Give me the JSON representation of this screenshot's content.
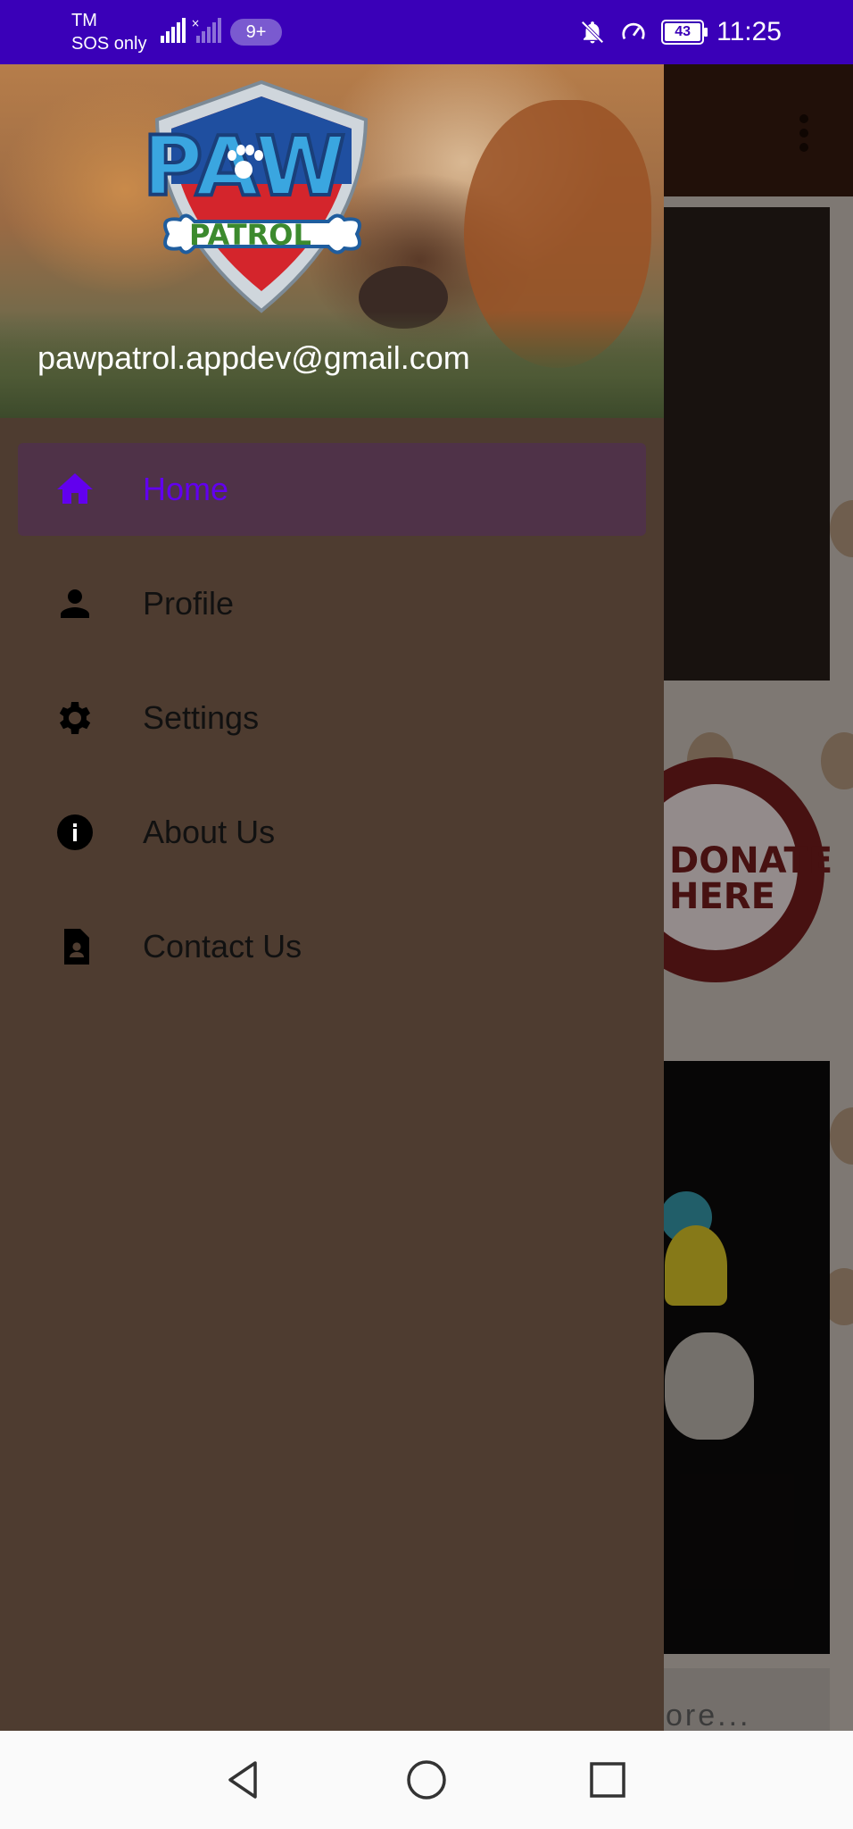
{
  "status_bar": {
    "carrier_line1": "TM",
    "carrier_line2": "SOS only",
    "notification_count": "9+",
    "battery": "43",
    "time": "11:25",
    "bg_color": "#3a00b8"
  },
  "drawer": {
    "email": "pawpatrol.appdev@gmail.com",
    "logo_text": "PAW",
    "logo_banner": "PATROL",
    "items": [
      {
        "label": "Home",
        "icon": "home-icon",
        "active": true
      },
      {
        "label": "Profile",
        "icon": "person-icon",
        "active": false
      },
      {
        "label": "Settings",
        "icon": "gear-icon",
        "active": false
      },
      {
        "label": "About Us",
        "icon": "info-icon",
        "active": false
      },
      {
        "label": "Contact Us",
        "icon": "contact-card-icon",
        "active": false
      }
    ],
    "accent_color": "#6200ee",
    "bg_color": "#4e3c30"
  },
  "background_app": {
    "donate_text_line1": "DONATE",
    "donate_text_line2": "HERE",
    "more_text": "ore..."
  },
  "nav_bar": {
    "back": "back-icon",
    "home": "home-circle-icon",
    "recents": "recents-icon"
  }
}
